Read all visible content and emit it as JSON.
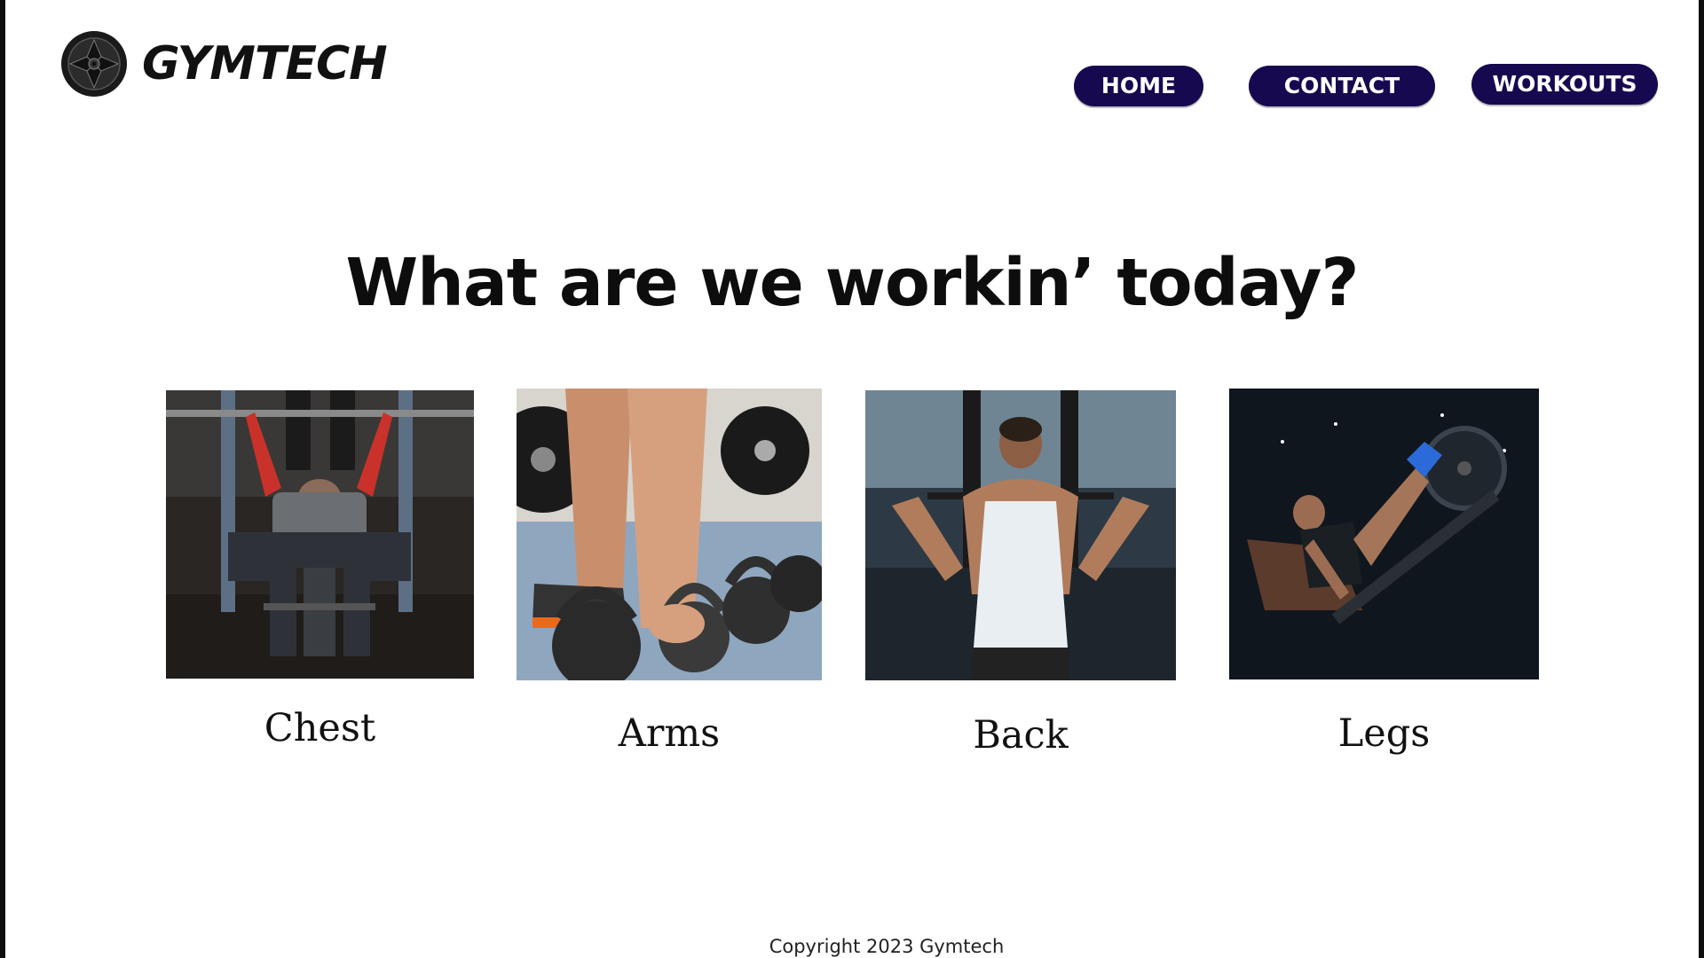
{
  "brand": {
    "name": "GYMTECH",
    "logo_icon": "barbell-plate-icon"
  },
  "nav": {
    "items": [
      {
        "label": "HOME"
      },
      {
        "label": "CONTACT"
      },
      {
        "label": "WORKOUTS"
      }
    ],
    "button_color": "#17094f"
  },
  "main": {
    "heading": "What are we workin’ today?",
    "categories": [
      {
        "label": "Chest",
        "image": "bench-press-photo"
      },
      {
        "label": "Arms",
        "image": "kettlebell-photo"
      },
      {
        "label": "Back",
        "image": "lat-pulldown-photo"
      },
      {
        "label": "Legs",
        "image": "leg-press-photo"
      }
    ]
  },
  "footer": {
    "copyright": "Copyright 2023 Gymtech"
  }
}
